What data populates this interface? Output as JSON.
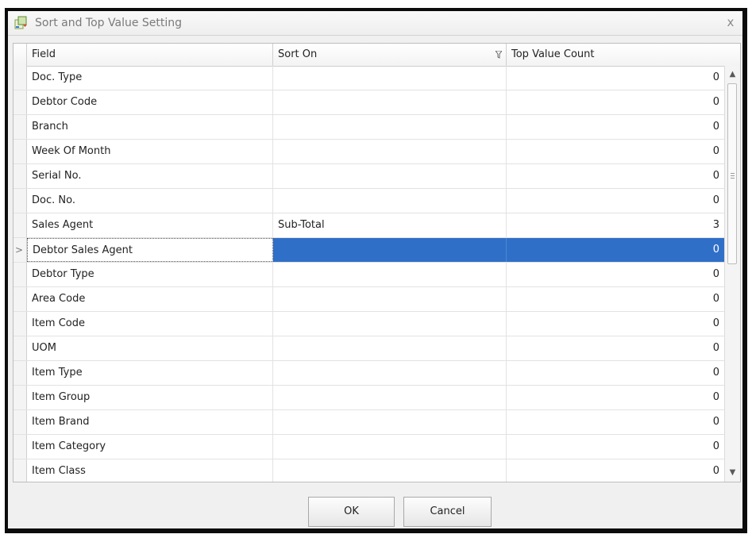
{
  "window": {
    "title": "Sort and Top Value Setting",
    "close_glyph": "x",
    "icon": "app-icon"
  },
  "grid": {
    "columns": [
      "Field",
      "Sort On",
      "Top Value Count"
    ],
    "filter_glyph": "ẋ",
    "current_row_marker": ">",
    "rows": [
      {
        "field": "Doc. Type",
        "sort_on": "",
        "top_value_count": "0"
      },
      {
        "field": "Debtor Code",
        "sort_on": "",
        "top_value_count": "0"
      },
      {
        "field": "Branch",
        "sort_on": "",
        "top_value_count": "0"
      },
      {
        "field": "Week Of Month",
        "sort_on": "",
        "top_value_count": "0"
      },
      {
        "field": "Serial No.",
        "sort_on": "",
        "top_value_count": "0"
      },
      {
        "field": "Doc. No.",
        "sort_on": "",
        "top_value_count": "0"
      },
      {
        "field": "Sales Agent",
        "sort_on": "Sub-Total",
        "top_value_count": "3"
      },
      {
        "field": "Debtor Sales Agent",
        "sort_on": "",
        "top_value_count": "0"
      },
      {
        "field": "Debtor Type",
        "sort_on": "",
        "top_value_count": "0"
      },
      {
        "field": "Area Code",
        "sort_on": "",
        "top_value_count": "0"
      },
      {
        "field": "Item Code",
        "sort_on": "",
        "top_value_count": "0"
      },
      {
        "field": "UOM",
        "sort_on": "",
        "top_value_count": "0"
      },
      {
        "field": "Item Type",
        "sort_on": "",
        "top_value_count": "0"
      },
      {
        "field": "Item Group",
        "sort_on": "",
        "top_value_count": "0"
      },
      {
        "field": "Item Brand",
        "sort_on": "",
        "top_value_count": "0"
      },
      {
        "field": "Item Category",
        "sort_on": "",
        "top_value_count": "0"
      },
      {
        "field": "Item Class",
        "sort_on": "",
        "top_value_count": "0"
      }
    ],
    "selected_row": 7,
    "selection_color": "#2f6fc8"
  },
  "buttons": {
    "ok_label": "OK",
    "cancel_label": "Cancel"
  }
}
